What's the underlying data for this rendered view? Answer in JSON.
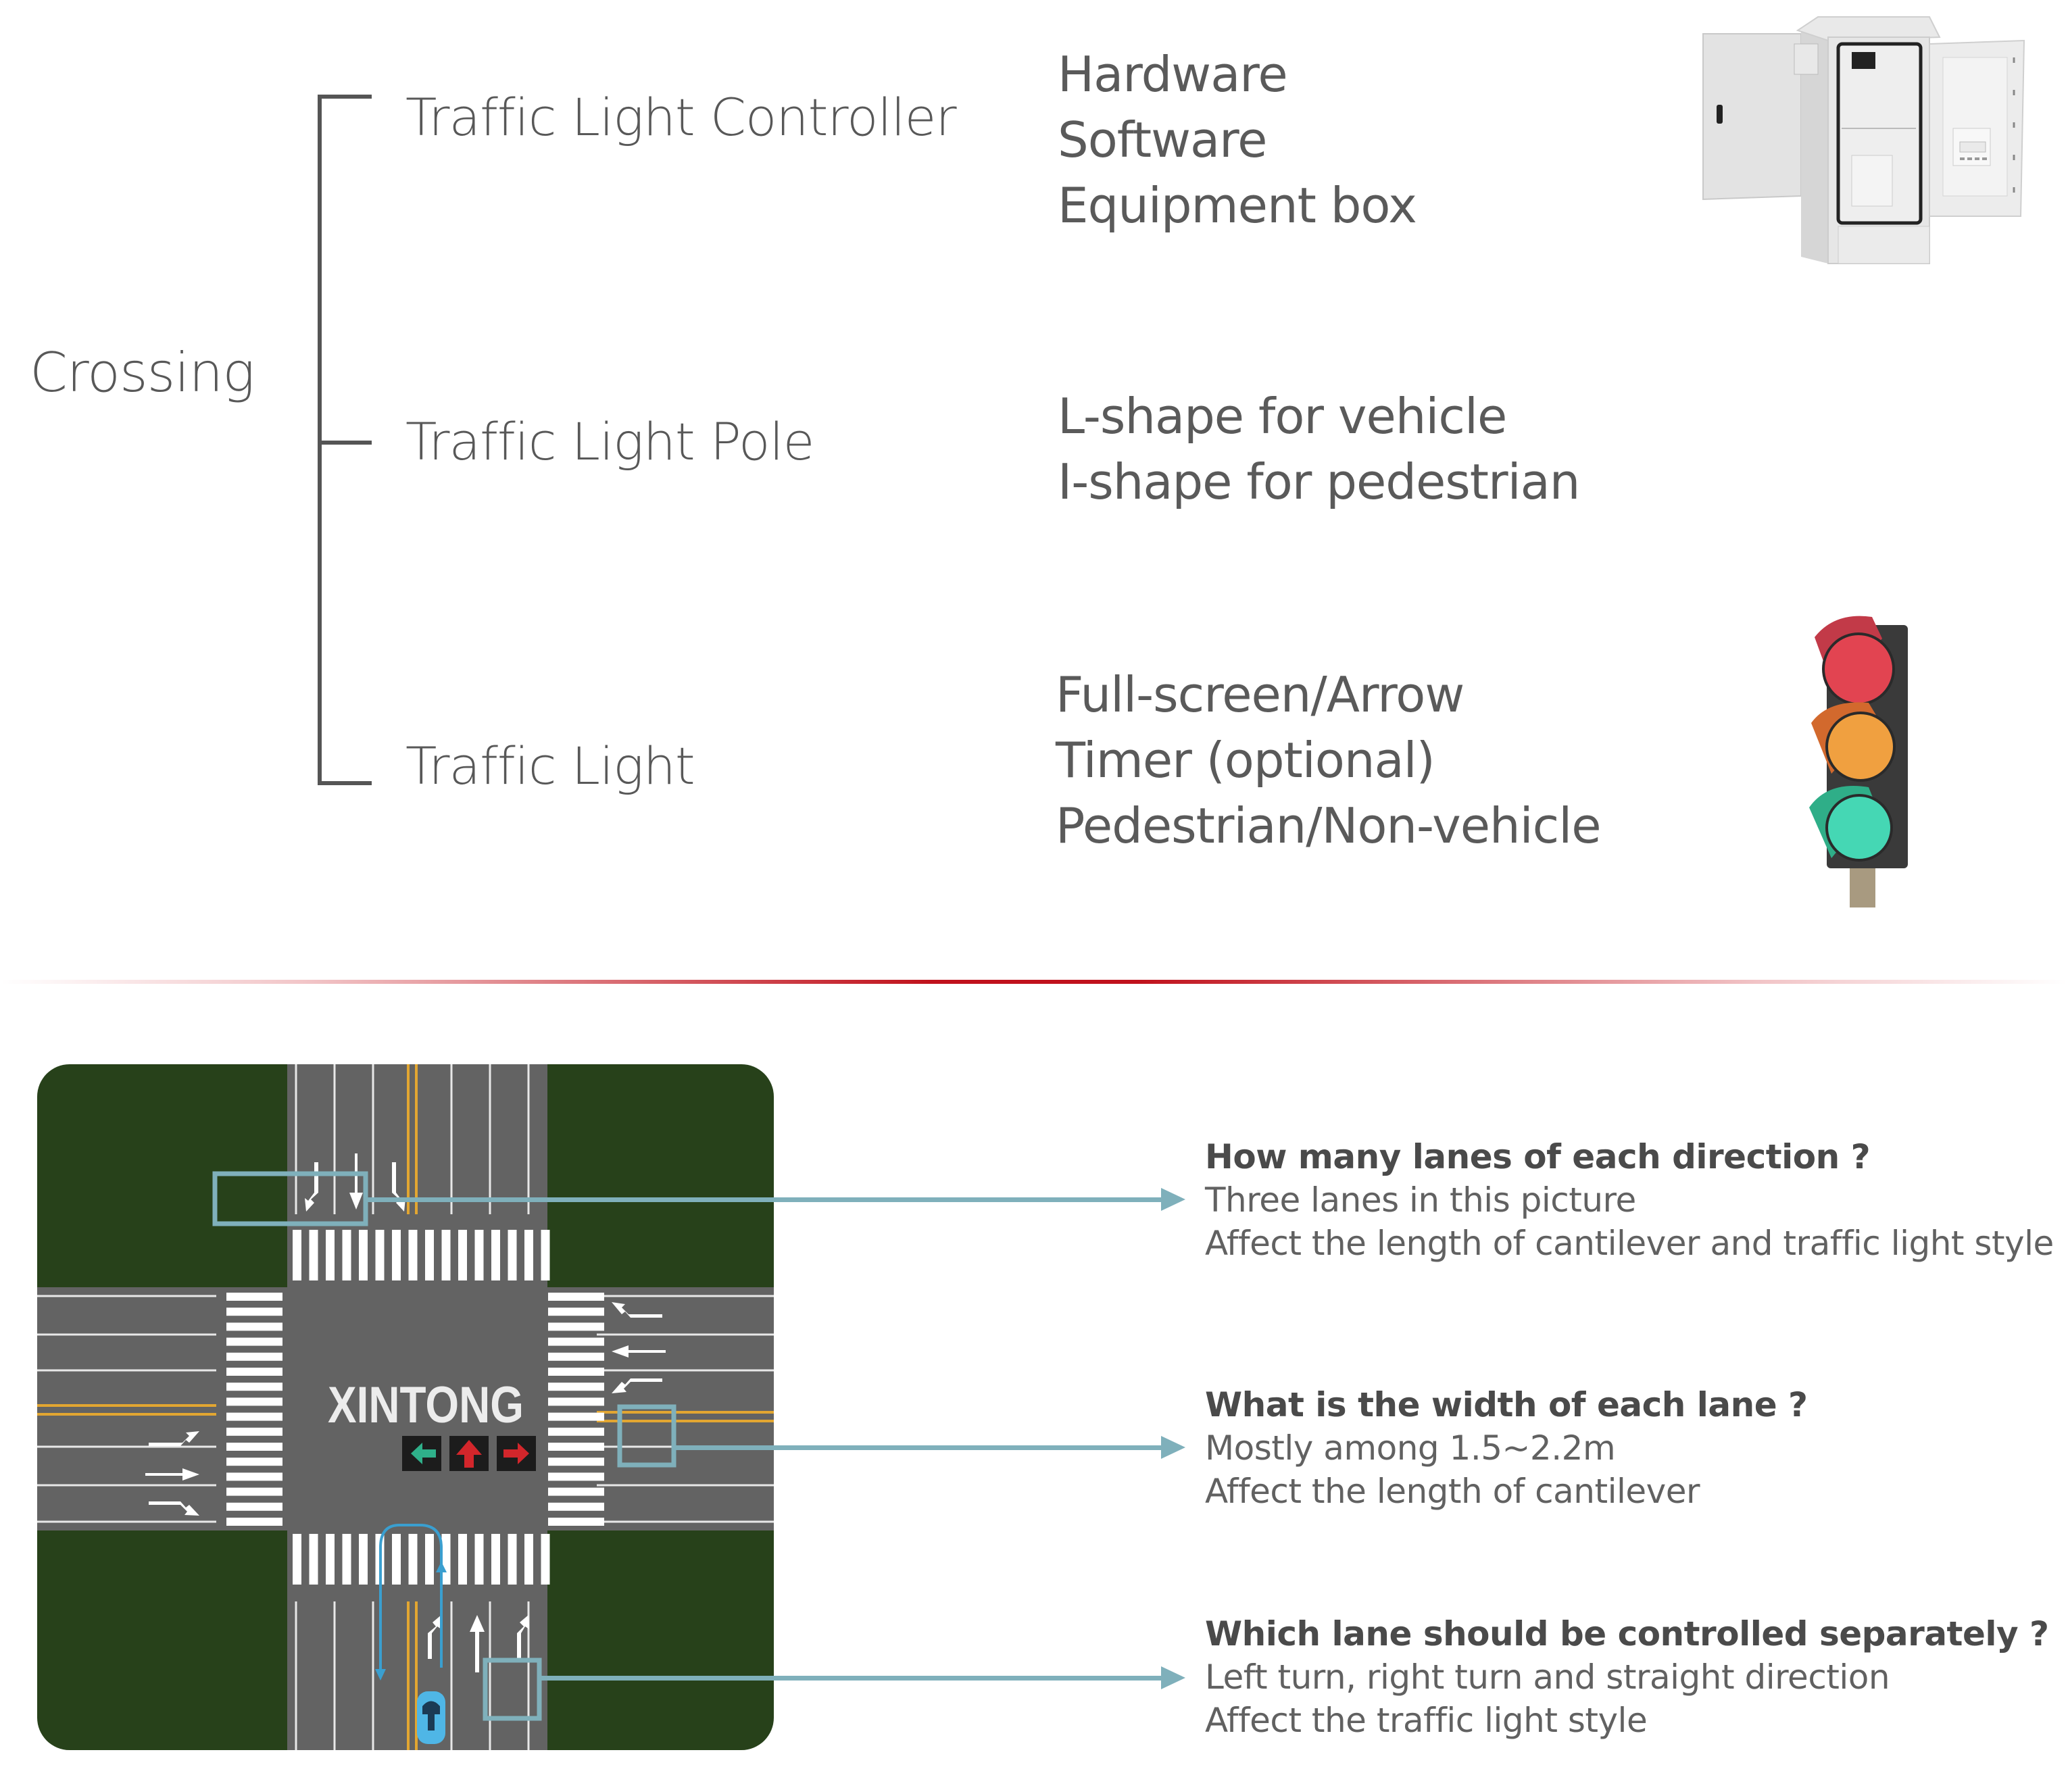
{
  "hierarchy": {
    "root": "Crossing",
    "branches": [
      {
        "label": "Traffic Light Controller",
        "details": [
          "Hardware",
          "Software",
          "Equipment box"
        ],
        "image": "equipment-cabinet"
      },
      {
        "label": "Traffic Light Pole",
        "details": [
          "L-shape for vehicle",
          "I-shape for pedestrian"
        ]
      },
      {
        "label": "Traffic Light",
        "details": [
          "Full-screen/Arrow",
          "Timer (optional)",
          "Pedestrian/Non-vehicle"
        ],
        "image": "three-aspect-traffic-light"
      }
    ]
  },
  "map": {
    "brand": "XINTONG",
    "signal_arrows": [
      {
        "direction": "left",
        "color": "#2fb08a"
      },
      {
        "direction": "up",
        "color": "#d3262b"
      },
      {
        "direction": "right",
        "color": "#d3262b"
      }
    ],
    "colors": {
      "grass": "#27411a",
      "road": "#636363",
      "lane_line": "#e8e8e8",
      "center_line": "#e2a631",
      "highlight": "#7fb0bb",
      "car": "#4fb6e6"
    }
  },
  "questions": [
    {
      "title": "How many lanes of each direction ?",
      "lines": [
        "Three lanes in this picture",
        "Affect the length of cantilever and traffic light style"
      ]
    },
    {
      "title": "What is the width of  each lane ?",
      "lines": [
        "Mostly among 1.5~2.2m",
        "Affect the length of cantilever"
      ]
    },
    {
      "title": "Which lane should be controlled separately ?",
      "lines": [
        "Left turn, right turn and straight direction",
        "Affect the traffic light style"
      ]
    }
  ],
  "colors": {
    "divider": "#c0121c",
    "text": "#585858",
    "callout": "#7fb0bb"
  }
}
